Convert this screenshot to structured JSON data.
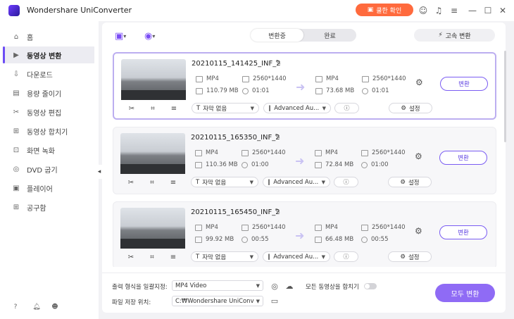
{
  "app": {
    "title": "Wondershare UniConverter",
    "promo_label": "쿨한 확인"
  },
  "sidebar": {
    "items": [
      {
        "label": "홈",
        "icon": "home-icon"
      },
      {
        "label": "동영상 변환",
        "icon": "video-convert-icon",
        "active": true
      },
      {
        "label": "다운로드",
        "icon": "download-icon"
      },
      {
        "label": "용량 줄이기",
        "icon": "compress-icon"
      },
      {
        "label": "동영상 편집",
        "icon": "scissors-icon"
      },
      {
        "label": "동영상 합치기",
        "icon": "merge-icon"
      },
      {
        "label": "화면 녹화",
        "icon": "screen-record-icon"
      },
      {
        "label": "DVD 굽기",
        "icon": "dvd-icon"
      },
      {
        "label": "플레이어",
        "icon": "player-icon"
      },
      {
        "label": "공구함",
        "icon": "toolbox-icon"
      }
    ]
  },
  "tabs": {
    "converting": "변환중",
    "completed": "완료"
  },
  "fast_convert_label": "고속 변환",
  "files": [
    {
      "name": "20210115_141425_INF_2",
      "src_format": "MP4",
      "src_res": "2560*1440",
      "src_size": "110.79 MB",
      "src_dur": "01:01",
      "dst_format": "MP4",
      "dst_res": "2560*1440",
      "dst_size": "73.68 MB",
      "dst_dur": "01:01",
      "subtitle": "자막 없음",
      "audio": "Advanced Au...",
      "settings": "설정",
      "convert": "변환"
    },
    {
      "name": "20210115_165350_INF_2",
      "src_format": "MP4",
      "src_res": "2560*1440",
      "src_size": "110.36 MB",
      "src_dur": "01:00",
      "dst_format": "MP4",
      "dst_res": "2560*1440",
      "dst_size": "72.84 MB",
      "dst_dur": "01:00",
      "subtitle": "자막 없음",
      "audio": "Advanced Au...",
      "settings": "설정",
      "convert": "변환"
    },
    {
      "name": "20210115_165450_INF_2",
      "src_format": "MP4",
      "src_res": "2560*1440",
      "src_size": "99.92 MB",
      "src_dur": "00:55",
      "dst_format": "MP4",
      "dst_res": "2560*1440",
      "dst_size": "66.48 MB",
      "dst_dur": "00:55",
      "subtitle": "자막 없음",
      "audio": "Advanced Au...",
      "settings": "설정",
      "convert": "변환"
    }
  ],
  "bottom": {
    "output_format_label": "출력 형식을 일괄지정:",
    "output_format_value": "MP4 Video",
    "merge_label": "모든 동영상을 합치기",
    "save_location_label": "파일 저장 위치:",
    "save_location_value": "C:₩Wondershare UniConverte",
    "convert_all_label": "모두 변환"
  },
  "colors": {
    "accent": "#8f6bf5",
    "promo": "#ff6a3d"
  }
}
